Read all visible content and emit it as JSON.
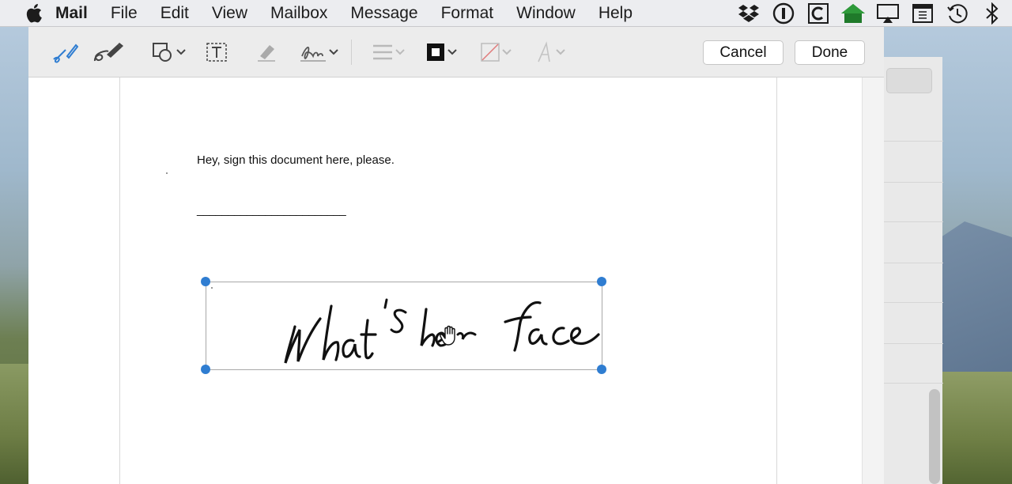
{
  "menubar": {
    "app_name": "Mail",
    "items": [
      "File",
      "Edit",
      "View",
      "Mailbox",
      "Message",
      "Format",
      "Window",
      "Help"
    ],
    "status_icons": [
      "dropbox-icon",
      "1password-icon",
      "clipboard-c-icon",
      "home-icon",
      "airplay-icon",
      "keyboard-icon",
      "time-machine-icon",
      "bluetooth-icon"
    ]
  },
  "toolbar": {
    "tools": [
      "sketch-tool",
      "draw-tool",
      "shapes-tool",
      "text-tool",
      "highlight-tool",
      "sign-tool",
      "line-style-tool",
      "border-color-tool",
      "fill-color-tool",
      "text-style-tool"
    ],
    "cancel_label": "Cancel",
    "done_label": "Done"
  },
  "document": {
    "body_text": "Hey, sign this document here, please.",
    "signature_line": "________________________",
    "signature_text": "What's her face"
  },
  "colors": {
    "accent": "#2f7dd1",
    "sketch_icon": "#2f7dd1"
  }
}
